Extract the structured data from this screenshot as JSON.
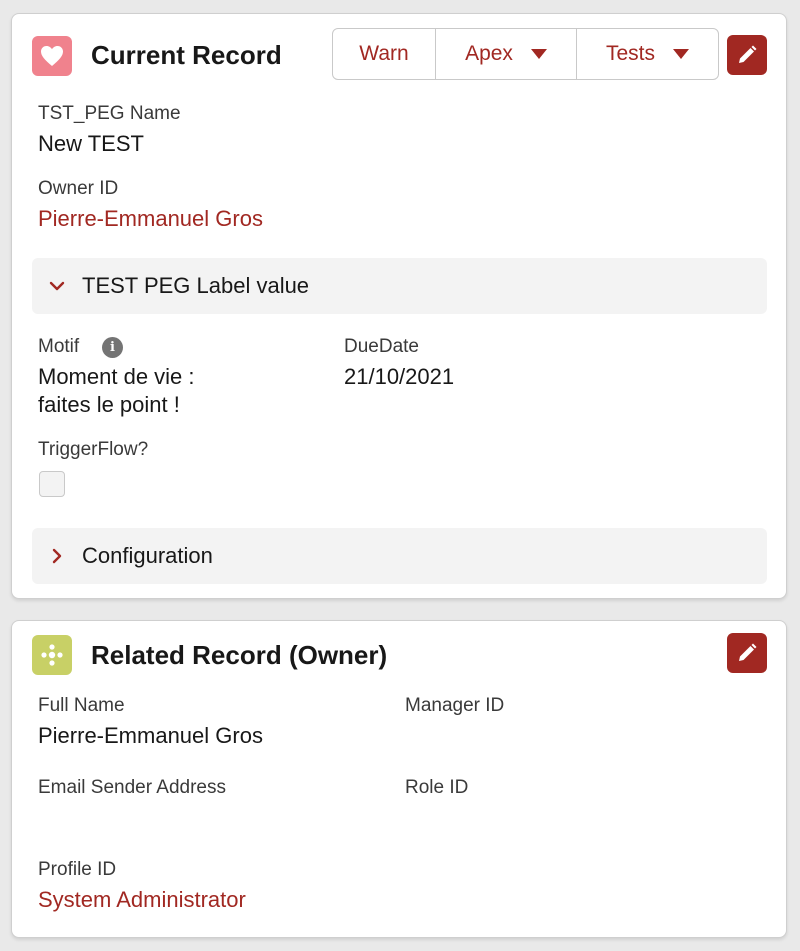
{
  "current_record": {
    "title": "Current Record",
    "icon": "heart-icon",
    "icon_color": "#f0828d",
    "buttons": {
      "warn_label": "Warn",
      "apex_label": "Apex",
      "tests_label": "Tests"
    },
    "edit_icon": "pencil-icon",
    "fields": {
      "name_label": "TST_PEG Name",
      "name_value": "New TEST",
      "owner_label": "Owner ID",
      "owner_value": "Pierre-Emmanuel Gros"
    },
    "section_expanded": {
      "title": "TEST PEG Label value",
      "state": "expanded",
      "motif_label": "Motif",
      "motif_value_line1": "Moment de vie :",
      "motif_value_line2": "faites le point !",
      "duedate_label": "DueDate",
      "duedate_value": "21/10/2021",
      "triggerflow_label": "TriggerFlow?",
      "triggerflow_checked": false
    },
    "section_collapsed": {
      "title": "Configuration",
      "state": "collapsed"
    }
  },
  "related_record": {
    "title": "Related Record (Owner)",
    "icon": "user-group-icon",
    "icon_color": "#c8d066",
    "edit_icon": "pencil-icon",
    "fields": {
      "full_name_label": "Full Name",
      "full_name_value": "Pierre-Emmanuel Gros",
      "manager_label": "Manager ID",
      "manager_value": "",
      "email_label": "Email Sender Address",
      "email_value": "",
      "role_label": "Role ID",
      "role_value": "",
      "profile_label": "Profile ID",
      "profile_value": "System Administrator"
    }
  },
  "colors": {
    "brand_red": "#a12822",
    "section_bg": "#f3f3f3",
    "page_bg": "#e9e9e9"
  }
}
